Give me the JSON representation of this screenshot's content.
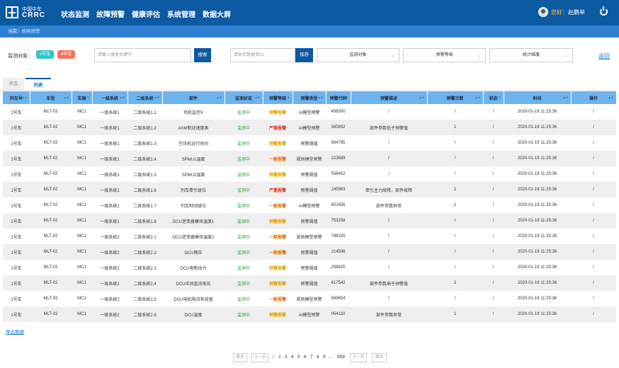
{
  "header": {
    "logo_cn": "中国中车",
    "logo_en": "CRRC",
    "nav": [
      "状态监测",
      "故障预警",
      "健康评估",
      "系统管理",
      "数据大屏"
    ],
    "user_greeting": "您好：",
    "user_name": "赵鹏举"
  },
  "breadcrumb": {
    "prefix": "当前：",
    "current": "故障预警"
  },
  "filters": {
    "label": "监测对象：",
    "tag1": "2号车",
    "tag2": "4号车",
    "search_placeholder": "请输入搜索关键字",
    "search_button": "搜索",
    "save_placeholder": "请命名数据单01",
    "save_button": "保存",
    "select1": "监测对象",
    "select2": "预警等级",
    "select3": "统计维度",
    "back": "返回"
  },
  "tabs": {
    "status": "状态",
    "list": "列表"
  },
  "table": {
    "columns": [
      "列车号",
      "车型",
      "车厢",
      "一级系统",
      "二级系统",
      "部件",
      "监测状态",
      "预警等级",
      "预警类型",
      "预警代码",
      "预警描述",
      "预警次数",
      "状态",
      "时间",
      "操作"
    ],
    "rows": [
      [
        "1号车",
        "MLT-02",
        "MC1",
        "一级系统1",
        "二级系统1.1",
        "司机监控V",
        "监测中",
        "预警报警",
        "AI模型预警",
        "456500",
        "/",
        "/",
        "/",
        "2020-01-19 11:25:36",
        "/"
      ],
      [
        "1号车",
        "MLT-02",
        "MC1",
        "一级系统1",
        "二级系统1.2",
        "AXM制动速度表",
        "监测中",
        "严重报警",
        "AI模型预警",
        "365892",
        "部件参数低于预警值",
        "1",
        "/",
        "2020-01-19 11:25:36",
        "/"
      ],
      [
        "1号车",
        "MLT-02",
        "MC1",
        "一级系统1",
        "二级系统1.3",
        "空压机运行时间",
        "监测中",
        "预警报警",
        "预警阈值",
        "564785",
        "/",
        "/",
        "/",
        "2020-01-19 11:25:36",
        "/"
      ],
      [
        "1号车",
        "MLT-02",
        "MC1",
        "一级系统1",
        "二级系统1.4",
        "SPMU1温度",
        "监测中",
        "一般报警",
        "规则模型预警",
        "223689",
        "/",
        "/",
        "/",
        "2020-01-19 11:25:36",
        "/"
      ],
      [
        "1号车",
        "MLT-02",
        "MC1",
        "一级系统1",
        "二级系统1.5",
        "SPMU2温度",
        "监测中",
        "预警报警",
        "预警阈值",
        "558452",
        "/",
        "/",
        "/",
        "2020-01-19 11:25:36",
        "/"
      ],
      [
        "1号车",
        "MLT-02",
        "MC1",
        "一级系统1",
        "二级系统1.6",
        "列车牵引级位",
        "监测中",
        "严重报警",
        "预警阈值",
        "145963",
        "牵引主力故障，部件故障",
        "1",
        "/",
        "2020-01-19 11:25:36",
        "/"
      ],
      [
        "1号车",
        "MLT-02",
        "MC1",
        "一级系统1",
        "二级系统1.7",
        "列车制动级位",
        "监测中",
        "一般报警",
        "AI模型预警",
        "852456",
        "部件参数异常",
        "1",
        "/",
        "2020-01-19 11:25:36",
        "/"
      ],
      [
        "1号车",
        "MLT-02",
        "MC1",
        "一级系统1",
        "二级系统1.8",
        "DCU逆变器模块温度1",
        "监测中",
        "预警报警",
        "预警阈值",
        "753258",
        "/",
        "/",
        "/",
        "2020-01-19 11:25:36",
        "/"
      ],
      [
        "1号车",
        "MLT-02",
        "MC1",
        "一级系统2",
        "二级系统2.1",
        "DCU逆变器模块温度2",
        "监测中",
        "一般报警",
        "规则模型预警",
        "786325",
        "/",
        "/",
        "/",
        "2020-01-19 11:25:36",
        "/"
      ],
      [
        "1号车",
        "MLT-02",
        "MC1",
        "一级系统2",
        "二级系统2.2",
        "DCU网压",
        "监测中",
        "一般报警",
        "预警阈值",
        "214596",
        "/",
        "/",
        "/",
        "2020-01-19 11:25:36",
        "/"
      ],
      [
        "1号车",
        "MLT-02",
        "MC1",
        "一级系统2",
        "二级系统2.3",
        "DCU电制动力",
        "监测中",
        "预警报警",
        "预警阈值",
        "258625",
        "/",
        "/",
        "/",
        "2020-01-19 11:25:36",
        "/"
      ],
      [
        "1号车",
        "MLT-02",
        "MC1",
        "一级系统2",
        "二级系统2.4",
        "DCU中间直流电压",
        "监测中",
        "预警报警",
        "预警阈值",
        "417542",
        "部件参数高于预警值",
        "2",
        "/",
        "2020-01-19 11:25:36",
        "/"
      ],
      [
        "1号车",
        "MLT-02",
        "MC1",
        "一级系统2",
        "二级系统2.5",
        "DCU电机电流有效值",
        "监测中",
        "一般报警",
        "规则模型预警",
        "569654",
        "/",
        "/",
        "/",
        "2020-01-19 11:25:36",
        "/"
      ],
      [
        "1号车",
        "MLT-02",
        "MC1",
        "一级系统2",
        "二级系统2.6",
        "DCU温度",
        "监测中",
        "预警报警",
        "AI模型预警",
        "054110",
        "部件参数异常",
        "1",
        "/",
        "2020-01-19 11:25:36",
        "/"
      ]
    ],
    "level_colors": {
      "预警报警": "#e0a100",
      "严重报警": "#e0301e",
      "一般报警": "#e06a00"
    }
  },
  "export_label": "导出数据",
  "pagination": {
    "first": "首页",
    "prev": "上一页",
    "pages": [
      "1",
      "2",
      "3",
      "4",
      "5",
      "6",
      "7",
      "8",
      "9"
    ],
    "active": "1",
    "ellipsis": "...",
    "last_page": "999",
    "next": "下一页",
    "end": "尾页"
  }
}
